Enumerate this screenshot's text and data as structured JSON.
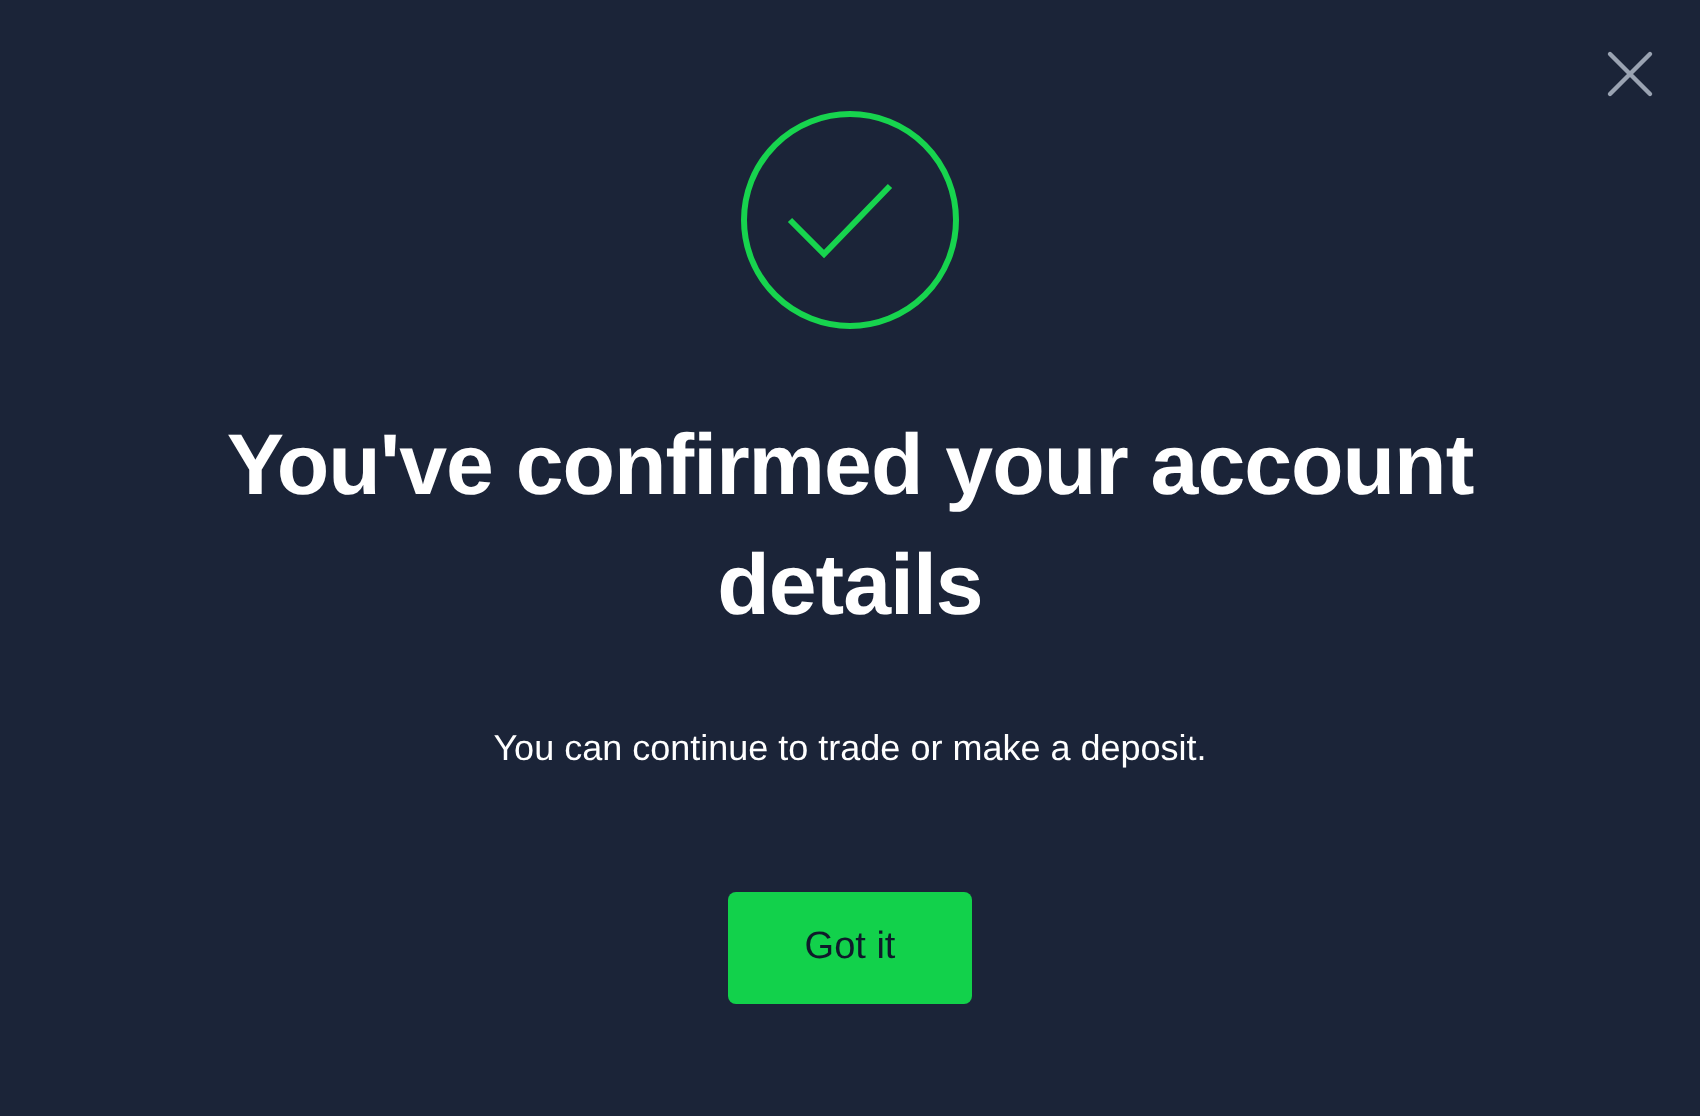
{
  "dialog": {
    "title": "You've confirmed your account details",
    "message": "You can continue to trade or make a deposit.",
    "button": "Got it"
  }
}
